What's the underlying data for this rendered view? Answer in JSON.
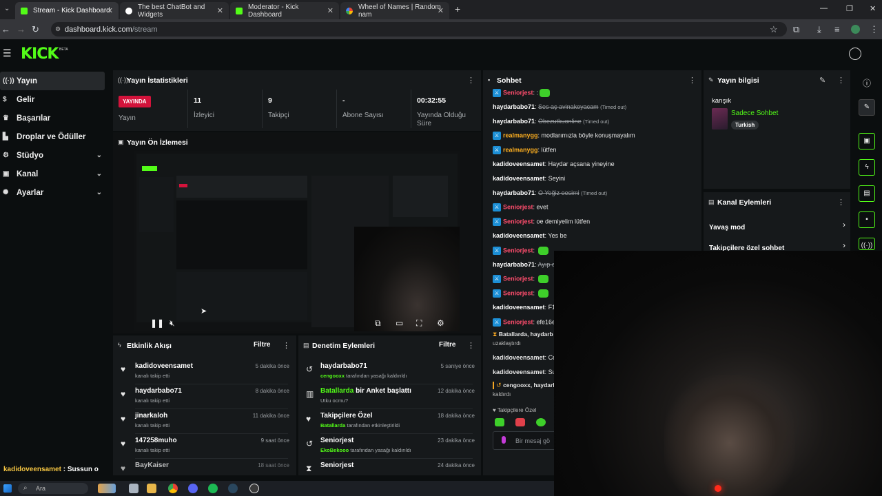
{
  "browser": {
    "tabs": [
      {
        "title": "Stream - Kick Dashboard",
        "fav": "#53fc18"
      },
      {
        "title": "The best ChatBot and Widgets",
        "fav": "#ffffff"
      },
      {
        "title": "Moderator - Kick Dashboard",
        "fav": "#53fc18"
      },
      {
        "title": "Wheel of Names | Random nam",
        "fav": "#4285f4"
      }
    ],
    "new_tab": "+",
    "url_host": "dashboard.kick.com",
    "url_path": "/stream"
  },
  "kick": {
    "logo": "KICK",
    "beta": "BETA"
  },
  "sidebar": {
    "items": [
      {
        "label": "Yayın",
        "icon": "broadcast-icon"
      },
      {
        "label": "Gelir",
        "icon": "dollar-icon"
      },
      {
        "label": "Başarılar",
        "icon": "trophy-icon"
      },
      {
        "label": "Droplar ve Ödüller",
        "icon": "gift-icon"
      },
      {
        "label": "Stüdyo",
        "icon": "studio-icon"
      },
      {
        "label": "Kanal",
        "icon": "channel-icon"
      },
      {
        "label": "Ayarlar",
        "icon": "gear-icon"
      }
    ]
  },
  "stats": {
    "title": "Yayın İstatistikleri",
    "live": "YAYINDA",
    "live_label": "Yayın",
    "viewers": "11",
    "viewers_label": "İzleyici",
    "followers": "9",
    "followers_label": "Takipçi",
    "subs": "-",
    "subs_label": "Abone Sayısı",
    "uptime": "00:32:55",
    "uptime_label": "Yayında Olduğu Süre"
  },
  "preview": {
    "title": "Yayın Ön İzlemesi"
  },
  "activity": {
    "title": "Etkinlik Akışı",
    "filter": "Filtre",
    "rows": [
      {
        "name": "kadidoveensamet",
        "sub": "kanalı takip etti",
        "time": "5 dakika önce"
      },
      {
        "name": "haydarbabo71",
        "sub": "kanalı takip etti",
        "time": "8 dakika önce"
      },
      {
        "name": "jinarkaloh",
        "sub": "kanalı takip etti",
        "time": "11 dakika önce"
      },
      {
        "name": "147258muho",
        "sub": "kanalı takip etti",
        "time": "9 saat önce"
      },
      {
        "name": "BayKaiser",
        "sub": "",
        "time": "18 saat önce"
      }
    ]
  },
  "moderation": {
    "title": "Denetim Eylemleri",
    "filter": "Filtre",
    "rows": [
      {
        "name": "haydarbabo71",
        "green": "cengooxx",
        "sub": "tarafından yasağı kaldırıldı",
        "time": "5 saniye önce"
      },
      {
        "name": "bir Anket başlattı",
        "namegreen": "Batallarda",
        "sub": "Utku ocmu?",
        "time": "12 dakika önce"
      },
      {
        "name": "Takipçilere Özel",
        "green": "Batallarda",
        "sub": "tarafından etkinleştirildi",
        "time": "18 dakika önce"
      },
      {
        "name": "Seniorjest",
        "green": "EkoBekooo",
        "sub": "tarafından yasağı kaldırıldı",
        "time": "23 dakika önce"
      },
      {
        "name": "Seniorjest",
        "green": "",
        "sub": "",
        "time": "24 dakika önce"
      }
    ]
  },
  "chat": {
    "title": "Sohbet",
    "messages": [
      {
        "user": "Seniorjest",
        "text": ":",
        "emote": true,
        "color": "#ff4d6d",
        "badge": true
      },
      {
        "user": "haydarbabo71",
        "text": "Ses aç avinakoyacam",
        "strike": true,
        "note": "(Timed out)",
        "color": "#ffffff"
      },
      {
        "user": "haydarbabo71",
        "text": "Obezutkuonline",
        "strike": true,
        "note": "(Timed out)",
        "color": "#ffffff"
      },
      {
        "user": "realmanygg",
        "text": "modlarımızla böyle konuşmayalım",
        "color": "#ffb020",
        "badge": true
      },
      {
        "user": "realmanygg",
        "text": "lütfen",
        "color": "#ffb020",
        "badge": true
      },
      {
        "user": "kadidoveensamet",
        "text": "Haydar açsana yineyine",
        "color": "#ffffff"
      },
      {
        "user": "kadidoveensamet",
        "text": "Seyini",
        "color": "#ffffff"
      },
      {
        "user": "haydarbabo71",
        "text": "O Yeğiz oesimi",
        "strike": true,
        "note": "(Timed out)",
        "color": "#ffffff"
      },
      {
        "user": "Seniorjest",
        "text": "evet",
        "color": "#ff4d6d",
        "badge": true
      },
      {
        "user": "Seniorjest",
        "text": "oe demiyelim lütfen",
        "color": "#ff4d6d",
        "badge": true
      },
      {
        "user": "kadidoveensamet",
        "text": "Yes be",
        "color": "#ffffff"
      },
      {
        "user": "Seniorjest",
        "text": "",
        "emote": true,
        "color": "#ff4d6d",
        "badge": true
      },
      {
        "user": "haydarbabo71",
        "text": "Ayıp o",
        "strike": true,
        "color": "#ffffff"
      },
      {
        "user": "Seniorjest",
        "text": "",
        "emote": true,
        "color": "#ff4d6d",
        "badge": true
      },
      {
        "user": "Seniorjest",
        "text": "",
        "emote": true,
        "color": "#ff4d6d",
        "badge": true
      },
      {
        "user": "kadidoveensamet",
        "text": "F1",
        "color": "#ffffff"
      },
      {
        "user": "Seniorjest",
        "text": "efe16e",
        "color": "#ff4d6d",
        "badge": true
      }
    ],
    "sys1": "Batallarda, haydarb",
    "sys1b": "uzaklaştırdı",
    "m_after1": {
      "user": "kadidoveensamet",
      "text": "Ce"
    },
    "m_after2": {
      "user": "kadidoveensamet",
      "text": "Su"
    },
    "sys2": "cengooxx, haydarb",
    "sys2b": "kaldırdı",
    "followers_only": "Takipçilere Özel",
    "input_placeholder": "Bir mesaj gö"
  },
  "info": {
    "title": "Yayın bilgisi",
    "category": "karışık",
    "stream_title": "Sadece Sohbet",
    "tag": "Turkish"
  },
  "actions": {
    "title": "Kanal Eylemleri",
    "slow": "Yavaş mod",
    "followers": "Takipçilere özel sohbet"
  },
  "overlay": {
    "user": "kadidoveensamet",
    "text": " : Sussun o"
  },
  "taskbar": {
    "search": "Ara"
  }
}
